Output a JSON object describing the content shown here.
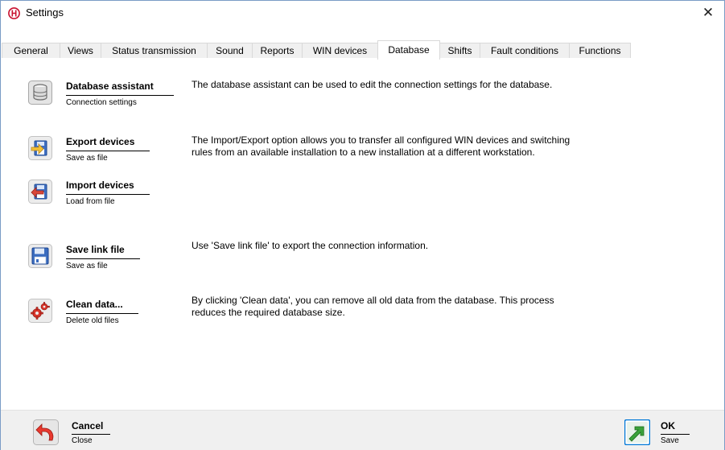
{
  "window": {
    "title": "Settings",
    "app_icon": "brand-logo-icon",
    "close_glyph": "✕"
  },
  "tabs": [
    {
      "label": "General",
      "active": false
    },
    {
      "label": "Views",
      "active": false
    },
    {
      "label": "Status transmission",
      "active": false
    },
    {
      "label": "Sound",
      "active": false
    },
    {
      "label": "Reports",
      "active": false
    },
    {
      "label": "WIN devices",
      "active": false
    },
    {
      "label": "Database",
      "active": true
    },
    {
      "label": "Shifts",
      "active": false
    },
    {
      "label": "Fault conditions",
      "active": false
    },
    {
      "label": "Functions",
      "active": false
    }
  ],
  "database": {
    "assistant": {
      "title": "Database assistant",
      "subtitle": "Connection settings",
      "icon": "database-icon",
      "description": "The database assistant can be used to edit the connection settings for the database."
    },
    "export": {
      "title": "Export devices",
      "subtitle": "Save as file",
      "icon": "export-icon",
      "description": "The Import/Export option allows you to transfer all configured WIN devices and switching rules from an available installation to a new installation at a different workstation."
    },
    "import": {
      "title": "Import devices",
      "subtitle": "Load from file",
      "icon": "import-icon"
    },
    "link_file": {
      "title": "Save link file",
      "subtitle": "Save as file",
      "icon": "floppy-disk-icon",
      "description": "Use 'Save link file' to export the connection information."
    },
    "clean": {
      "title": "Clean data...",
      "subtitle": "Delete old files",
      "icon": "gears-icon",
      "description": "By clicking 'Clean data', you can remove all old data from the database. This process reduces the required database size."
    }
  },
  "footer": {
    "cancel": {
      "title": "Cancel",
      "subtitle": "Close",
      "icon": "undo-arrow-icon"
    },
    "ok": {
      "title": "OK",
      "subtitle": "Save",
      "icon": "check-arrow-icon"
    }
  },
  "colors": {
    "accent": "#0078d7",
    "brand_red": "#c8102e"
  }
}
